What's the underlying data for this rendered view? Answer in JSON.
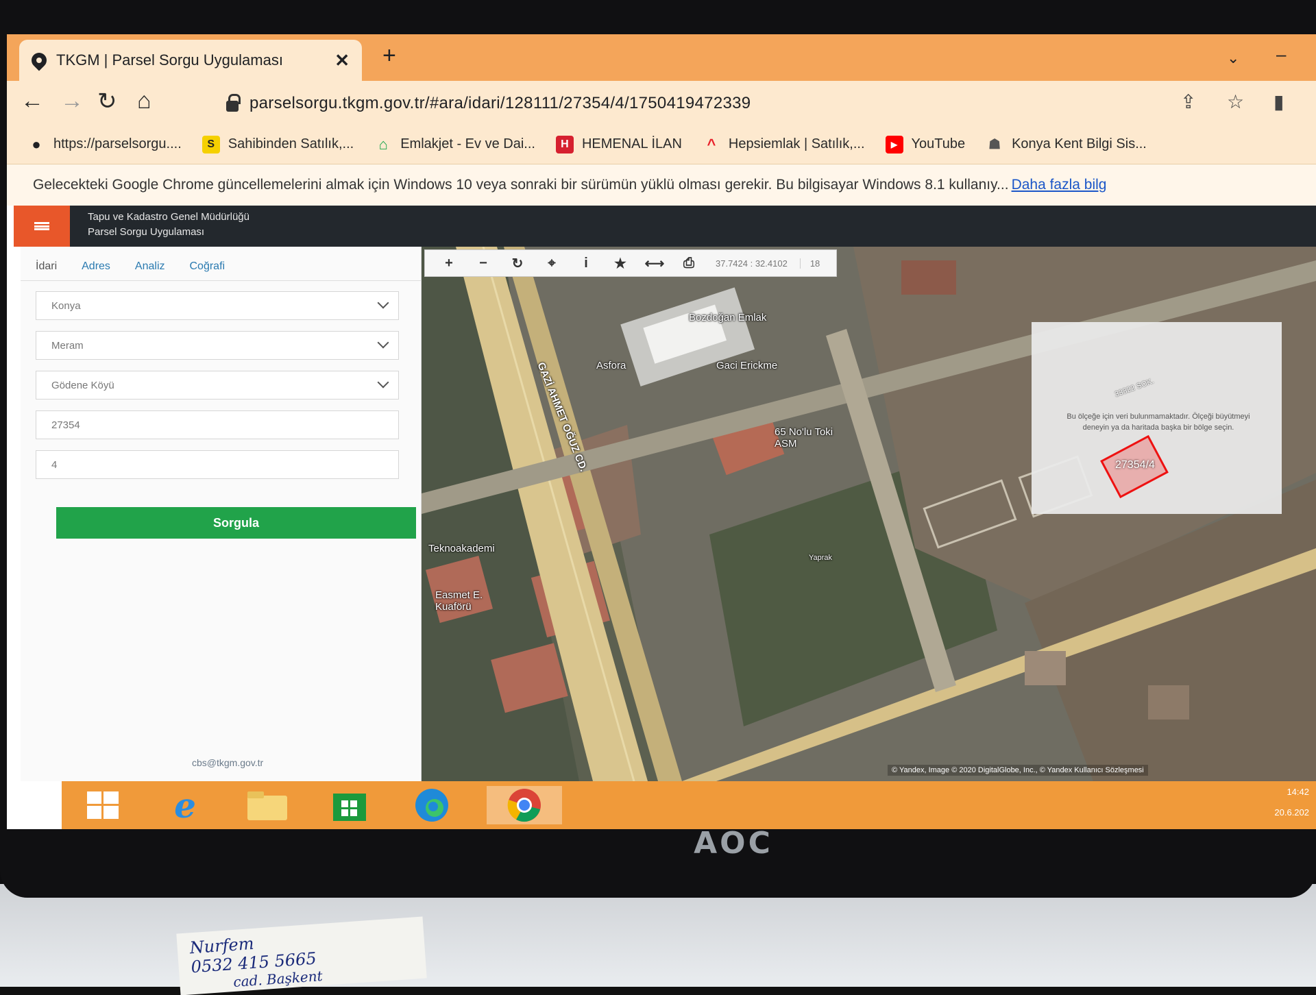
{
  "browser": {
    "tab_title": "TKGM | Parsel Sorgu Uygulaması",
    "tab_close": "✕",
    "new_tab": "+",
    "url": "parselsorgu.tkgm.gov.tr/#ara/idari/128111/27354/4/1750419472339",
    "bookmarks": [
      {
        "label": "https://parselsorgu....",
        "icon": "map-pin-icon",
        "color": "#202124"
      },
      {
        "label": "Sahibinden Satılık,...",
        "icon": "sahibinden-icon",
        "color": "#f5d000"
      },
      {
        "label": "Emlakjet - Ev ve Dai...",
        "icon": "house-icon",
        "color": "#16a34a"
      },
      {
        "label": "HEMENAL İLAN",
        "icon": "hemenal-icon",
        "color": "#d6202f"
      },
      {
        "label": "Hepsiemlak | Satılık,...",
        "icon": "roof-icon",
        "color": "#e8202a"
      },
      {
        "label": "YouTube",
        "icon": "youtube-icon",
        "color": "#ff0000"
      },
      {
        "label": "Konya Kent Bilgi Sis...",
        "icon": "konya-icon",
        "color": "#555555"
      }
    ],
    "infobar_text": "Gelecekteki Google Chrome güncellemelerini almak için Windows 10 veya sonraki bir sürümün yüklü olması gerekir. Bu bilgisayar Windows 8.1 kullanıy...",
    "infobar_link": "Daha fazla bilg"
  },
  "app": {
    "org_name": "Tapu ve Kadastro Genel Müdürlüğü",
    "app_name": "Parsel Sorgu Uygulaması",
    "accent": "#e8572a",
    "tabs": [
      "İdari",
      "Adres",
      "Analiz",
      "Coğrafi"
    ],
    "fields": {
      "il": "Konya",
      "ilce": "Meram",
      "mahalle": "Gödene Köyü",
      "ada": "27354",
      "parsel": "4"
    },
    "query_button": "Sorgula",
    "footer_email": "cbs@tkgm.gov.tr"
  },
  "map": {
    "coordinates": "37.7424 : 32.4102",
    "zoom": "18",
    "no_data_title": "33322 SOK.",
    "no_data_text": "Bu ölçeğe için veri bulunmamaktadır. Ölçeği büyütmeyi deneyin ya da haritada başka bir bölge seçin.",
    "parcel_label": "27354/4",
    "attribution": "© Yandex, Image © 2020 DigitalGlobe, Inc., © Yandex Kullanıcı Sözleşmesi",
    "labels": [
      {
        "text": "Bozdoğan Emlak"
      },
      {
        "text": "Asfora"
      },
      {
        "text": "Gaci Erickme"
      },
      {
        "text": "65 No'lu Toki ASM"
      },
      {
        "text": "GAZİ AHMET OĞUZ CD."
      },
      {
        "text": "Teknoakademi"
      },
      {
        "text": "Easmet E. Kuaförü"
      },
      {
        "text": "Yaprak"
      }
    ]
  },
  "taskbar": {
    "time": "14:42",
    "date": "20.6.202"
  },
  "monitor": {
    "brand": "AOC",
    "note_line1": "Nurfem",
    "note_line2": "0532 415 5665",
    "note_line3": "cad. Başkent"
  }
}
